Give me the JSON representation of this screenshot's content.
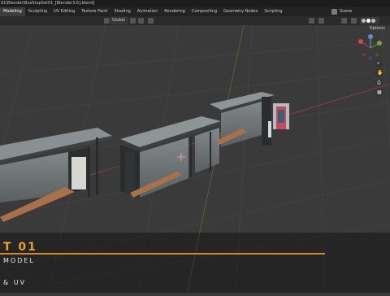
{
  "title_bar": {
    "text": "01\\Blender\\BusStopSet01_[Blender3.6].blend]"
  },
  "workspace_tabs": [
    "Modeling",
    "Sculpting",
    "UV Editing",
    "Texture Paint",
    "Shading",
    "Animation",
    "Rendering",
    "Compositing",
    "Geometry Nodes",
    "Scripting"
  ],
  "active_tab_index": 0,
  "scene": {
    "label": "Scene"
  },
  "toolbar": {
    "orientation": "Global"
  },
  "viewport": {
    "options_label": "Options",
    "gizmo": {
      "x_label": "X",
      "y_label": "Y",
      "z_label": "Z"
    },
    "overlay_text": {
      "line1": "T 01",
      "line2": "MODEL",
      "line3": "& UV"
    }
  },
  "colors": {
    "accent": "#d18b1e",
    "grid": "#4a4a4a",
    "x_axis": "#b9474a",
    "y_axis": "#7aa33a"
  }
}
